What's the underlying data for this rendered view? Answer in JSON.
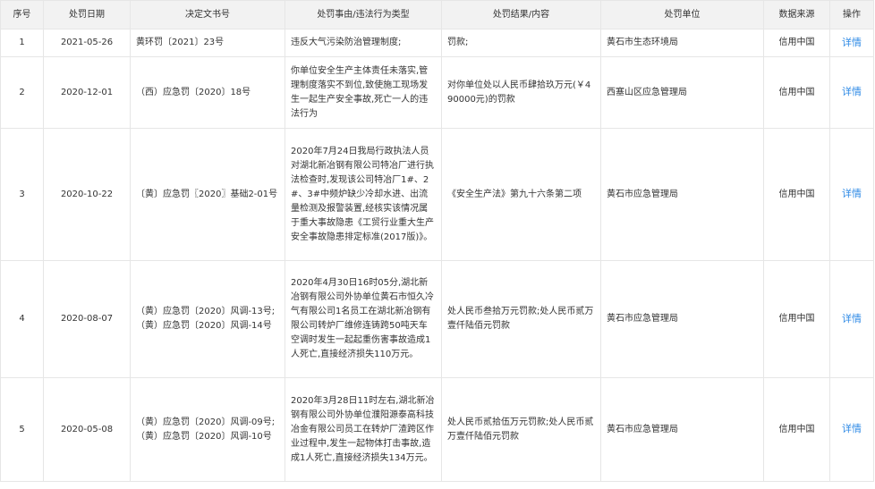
{
  "colors": {
    "header_bg": "#f2f2f2",
    "border": "#e6e6e6",
    "link": "#2e8ae6",
    "text": "#333333"
  },
  "headers": {
    "index": "序号",
    "date": "处罚日期",
    "doc_no": "决定文书号",
    "reason": "处罚事由/违法行为类型",
    "result": "处罚结果/内容",
    "unit": "处罚单位",
    "source": "数据来源",
    "action": "操作"
  },
  "rows": [
    {
      "index": "1",
      "date": "2021-05-26",
      "doc_no": "黄环罚〔2021〕23号",
      "reason": "违反大气污染防治管理制度;",
      "result": "罚款;",
      "unit": "黄石市生态环境局",
      "source": "信用中国",
      "action": "详情"
    },
    {
      "index": "2",
      "date": "2020-12-01",
      "doc_no": "（西）应急罚〔2020〕18号",
      "reason": "你单位安全生产主体责任未落实,管理制度落实不到位,致使施工现场发生一起生产安全事故,死亡一人的违法行为",
      "result": "对你单位处以人民币肆拾玖万元(￥490000元)的罚款",
      "unit": "西塞山区应急管理局",
      "source": "信用中国",
      "action": "详情"
    },
    {
      "index": "3",
      "date": "2020-10-22",
      "doc_no": "〔黄〕应急罚〖2020〗基础2-01号",
      "reason": "2020年7月24日我局行政执法人员对湖北新冶钢有限公司特冶厂进行执法检查时,发现该公司特冶厂1#、2#、3#中频炉缺少冷却水进、出流量检测及报警装置,经核实该情况属于重大事故隐患《工贸行业重大生产安全事故隐患排定标准(2017版)》。",
      "result": "《安全生产法》第九十六条第二项",
      "unit": "黄石市应急管理局",
      "source": "信用中国",
      "action": "详情"
    },
    {
      "index": "4",
      "date": "2020-08-07",
      "doc_no": "（黄）应急罚〔2020〕风调-13号;（黄）应急罚〔2020〕风调-14号",
      "reason": "2020年4月30日16时05分,湖北新冶钢有限公司外协单位黄石市恒久冷气有限公司1名员工在湖北新冶钢有限公司转炉厂维修连铸跨50吨天车空调时发生一起起重伤害事故造成1人死亡,直接经济损失110万元。",
      "result": "处人民币叁拾万元罚款;处人民币贰万壹仟陆佰元罚款",
      "unit": "黄石市应急管理局",
      "source": "信用中国",
      "action": "详情"
    },
    {
      "index": "5",
      "date": "2020-05-08",
      "doc_no": "（黄）应急罚〔2020〕风调-09号;（黄）应急罚〔2020〕风调-10号",
      "reason": "2020年3月28日11时左右,湖北新冶钢有限公司外协单位濮阳源泰高科技冶金有限公司员工在转炉厂渣跨区作业过程中,发生一起物体打击事故,造成1人死亡,直接经济损失134万元。",
      "result": "处人民币贰拾伍万元罚款;处人民币贰万壹仟陆佰元罚款",
      "unit": "黄石市应急管理局",
      "source": "信用中国",
      "action": "详情"
    }
  ]
}
